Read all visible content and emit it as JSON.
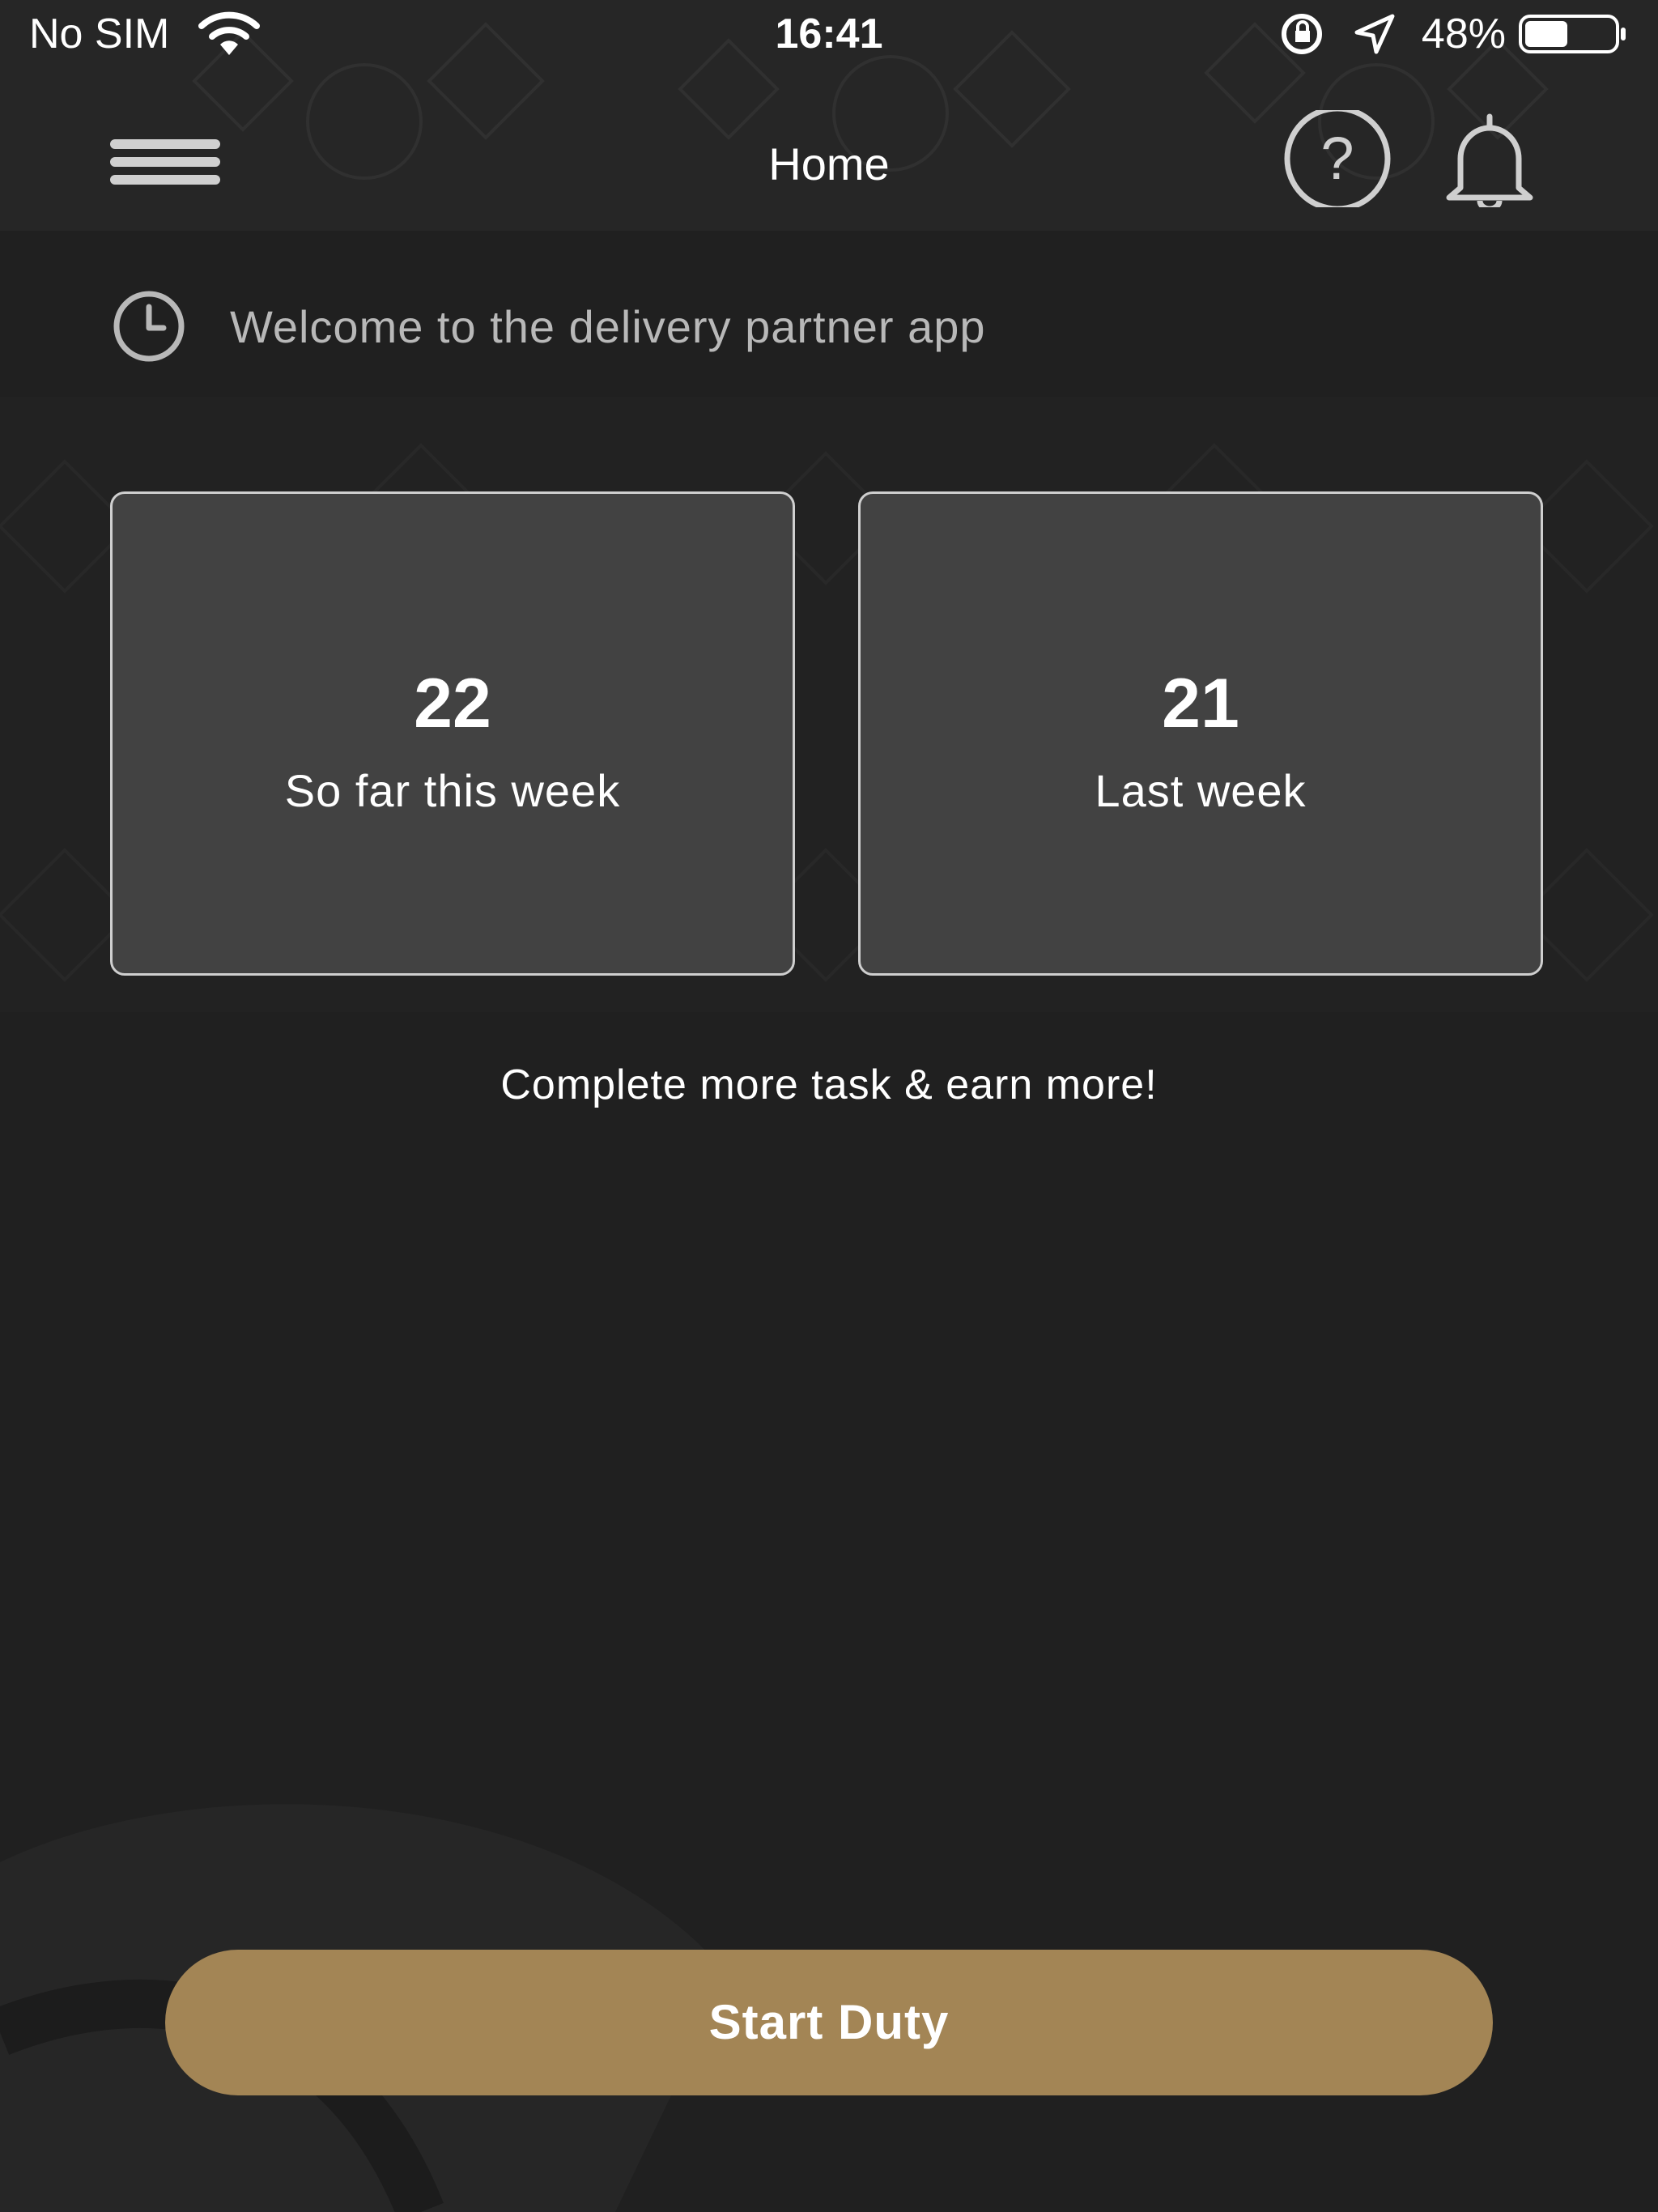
{
  "status_bar": {
    "carrier": "No SIM",
    "time": "16:41",
    "battery": "48%",
    "battery_level": 0.48
  },
  "header": {
    "title": "Home"
  },
  "welcome": {
    "text": "Welcome to the delivery partner app"
  },
  "stats": [
    {
      "value": "22",
      "label": "So far this week"
    },
    {
      "value": "21",
      "label": "Last week"
    }
  ],
  "motivation": {
    "text": "Complete more task & earn more!"
  },
  "actions": {
    "start_duty": "Start Duty"
  },
  "colors": {
    "background": "#202020",
    "card": "#424242",
    "card_border": "#cfcfcf",
    "accent": "#a38555"
  }
}
